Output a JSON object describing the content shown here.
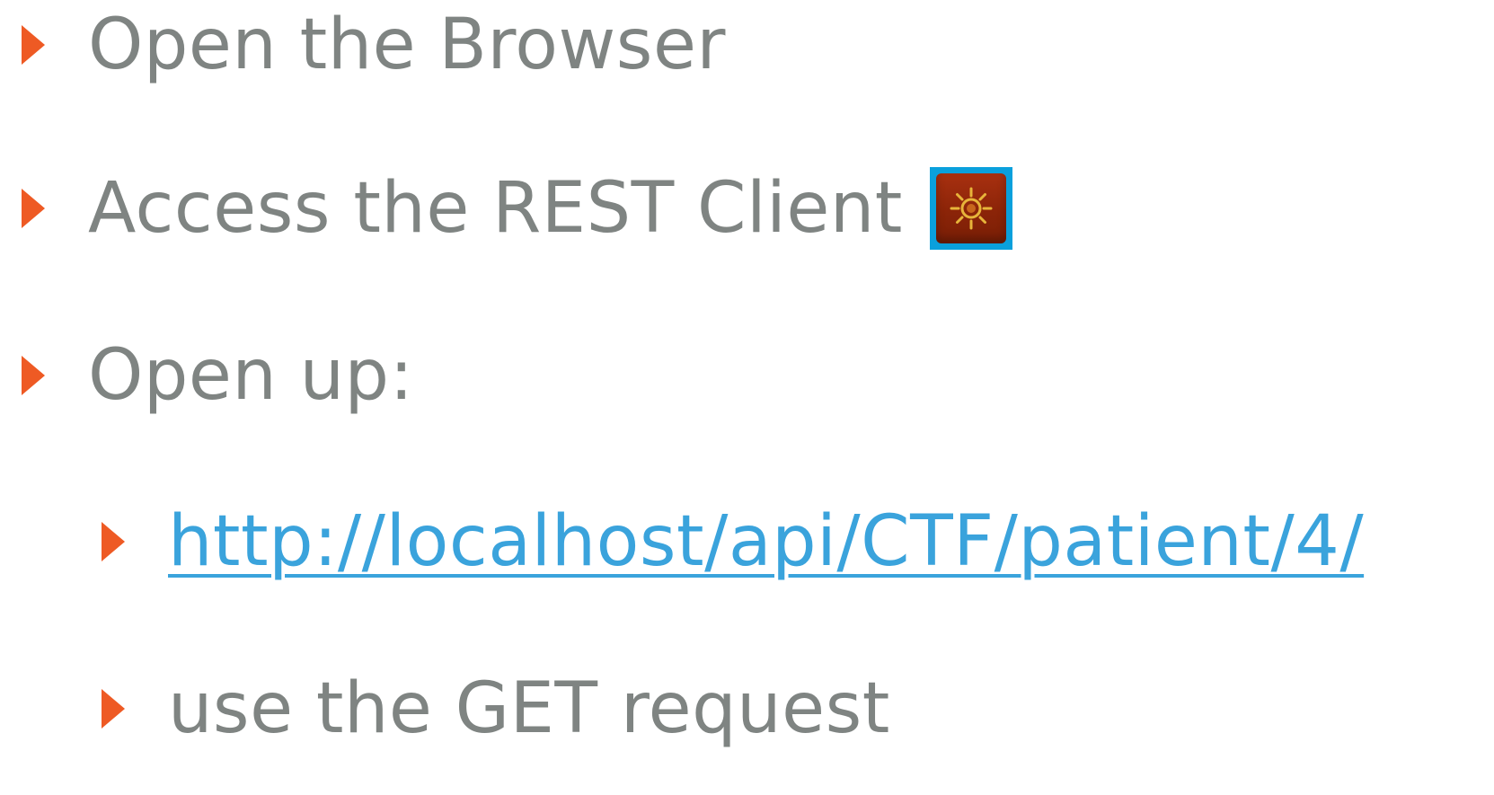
{
  "colors": {
    "bullet": "#ee5a24",
    "text": "#7f8482",
    "link": "#3aa3dc",
    "icon_frame": "#0aa0dc",
    "icon_body": "#8b2408",
    "icon_sun": "#e7b43a"
  },
  "items": [
    {
      "text": "Open the Browser"
    },
    {
      "text": "Access the REST Client",
      "icon": "rest-client-icon"
    },
    {
      "text": "Open up:"
    }
  ],
  "subitems": [
    {
      "text": "http://localhost/api/CTF/patient/4/"
    },
    {
      "text": "use the GET request"
    }
  ]
}
